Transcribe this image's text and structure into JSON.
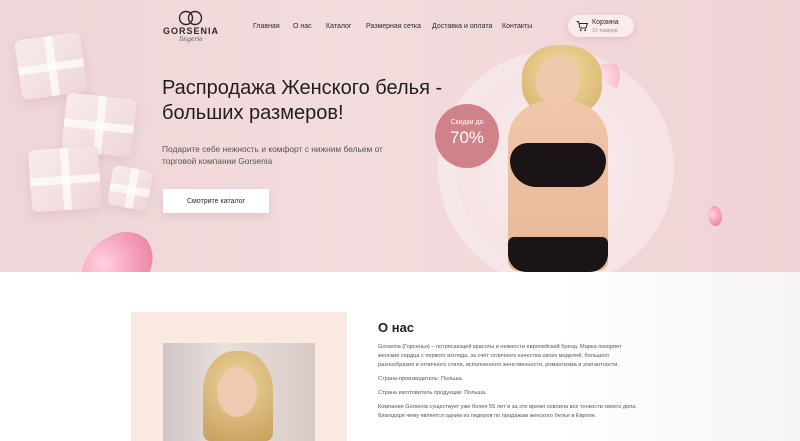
{
  "header": {
    "logo_text": "GORSENIA",
    "logo_sub": "lingerie",
    "nav": [
      "Главная",
      "О нас",
      "Каталог",
      "Размерная сетка",
      "Доставка и оплата",
      "Контакты"
    ],
    "cart": {
      "title": "Корзина",
      "count": "10 товаров"
    }
  },
  "hero": {
    "title": "Распродажа Женского белья - больших размеров!",
    "subtitle": "Подарите себе нежность и комфорт с нижним бельем от торговой компании Gorsenia",
    "cta_label": "Смотрите каталог",
    "badge_small": "Скидки до",
    "badge_big": "70%"
  },
  "about": {
    "title": "О нас",
    "paragraphs": [
      "Gorsenia (Горсенья) – потрясающей красоты и нежности европейский бренд. Марка покоряет женские сердца с первого взгляда, за счёт отличного качества своих моделей, большого разнообразия и отличного стиля, исполненного женственности, романтизма и элегантности.",
      "Страна-производитель: Польша.",
      "Страна изготовитель продукции: Польша.",
      "Компания Gorsenia существует уже более 55 лет и за это время освоила все тонкости своего дела, благодаря чему является одним из лидеров по продажам женского белья в Европе."
    ]
  },
  "colors": {
    "hero_bg": "#f0d6d8",
    "badge": "#cf8288",
    "about_card": "#fae9e1"
  },
  "icons": [
    "logo-gc-icon",
    "cart-icon"
  ]
}
